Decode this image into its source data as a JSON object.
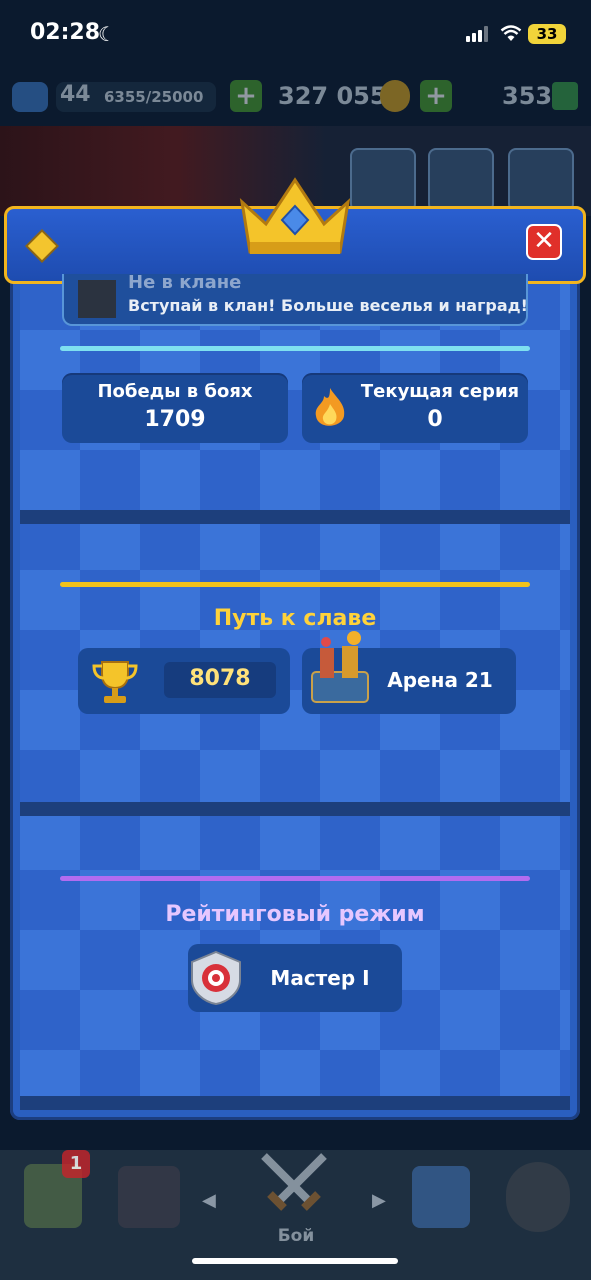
{
  "status_bar": {
    "time": "02:28",
    "battery": "33"
  },
  "game_bar": {
    "level": "44",
    "xp": "6355/25000",
    "gold": "327 055",
    "gems": "353"
  },
  "panel": {
    "clan": {
      "title": "Не в клане",
      "subtitle": "Вступай в клан! Больше веселья и наград!"
    },
    "stats": {
      "wins_label": "Победы в боях",
      "wins_value": "1709",
      "streak_label": "Текущая серия",
      "streak_value": "0"
    },
    "path_of_legends": {
      "title": "Путь к славе",
      "trophies": "8078",
      "arena": "Арена 21"
    },
    "ranked": {
      "title": "Рейтинговый режим",
      "league": "Мастер I"
    }
  },
  "bottom_nav": {
    "battle_label": "Бой",
    "badge": "1"
  },
  "colors": {
    "gold_rule": "#f1c21c",
    "purple_rule": "#b26cf0",
    "cyan_rule": "#7fe0f0",
    "close": "#e0302a"
  }
}
